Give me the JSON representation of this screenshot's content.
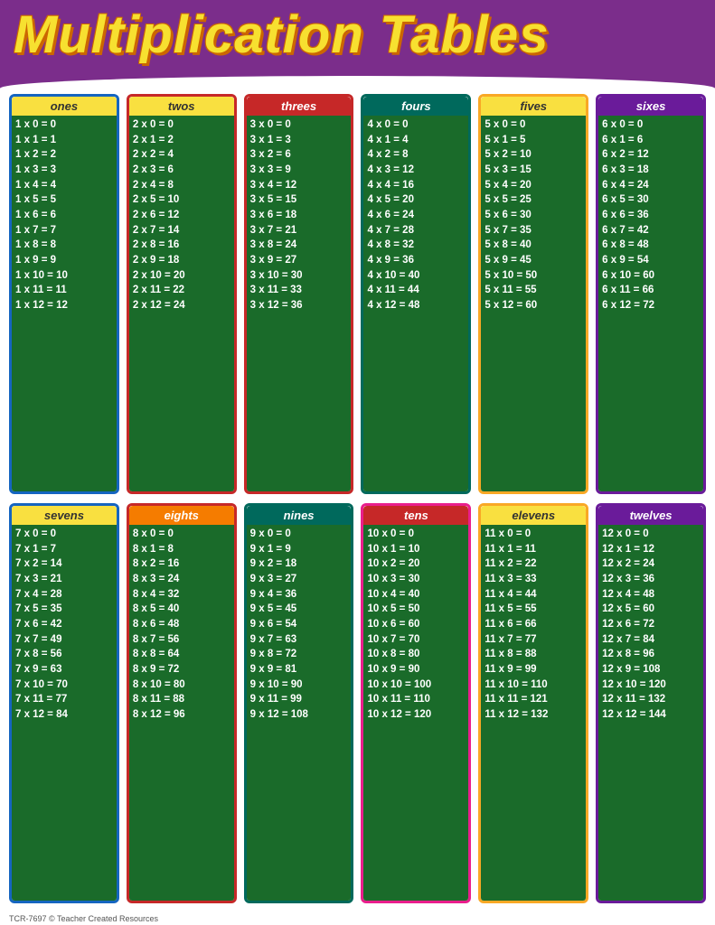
{
  "header": {
    "title": "Multiplication Tables"
  },
  "footer": "TCR-7697  © Teacher Created Resources",
  "tables": [
    {
      "name": "ones",
      "headerClass": "header-yellow",
      "borderClass": "border-blue",
      "rows": [
        "1x0=0",
        "1x1=1",
        "1x2=2",
        "1x3=3",
        "1x4=4",
        "1x5=5",
        "1x6=6",
        "1x7=7",
        "1x8=8",
        "1x9=9",
        "1x10=10",
        "1x11=11",
        "1x12=12"
      ]
    },
    {
      "name": "twos",
      "headerClass": "header-yellow",
      "borderClass": "border-red",
      "rows": [
        "2x0=0",
        "2x1=2",
        "2x2=4",
        "2x3=6",
        "2x4=8",
        "2x5=10",
        "2x6=12",
        "2x7=14",
        "2x8=16",
        "2x9=18",
        "2x10=20",
        "2x11=22",
        "2x12=24"
      ]
    },
    {
      "name": "threes",
      "headerClass": "header-red",
      "borderClass": "border-red",
      "rows": [
        "3x0=0",
        "3x1=3",
        "3x2=6",
        "3x3=9",
        "3x4=12",
        "3x5=15",
        "3x6=18",
        "3x7=21",
        "3x8=24",
        "3x9=27",
        "3x10=30",
        "3x11=33",
        "3x12=36"
      ]
    },
    {
      "name": "fours",
      "headerClass": "header-teal",
      "borderClass": "border-teal",
      "rows": [
        "4x0=0",
        "4x1=4",
        "4x2=8",
        "4x3=12",
        "4x4=16",
        "4x5=20",
        "4x6=24",
        "4x7=28",
        "4x8=32",
        "4x9=36",
        "4x10=40",
        "4x11=44",
        "4x12=48"
      ]
    },
    {
      "name": "fives",
      "headerClass": "header-yellow",
      "borderClass": "border-yellow",
      "rows": [
        "5x0=0",
        "5x1=5",
        "5x2=10",
        "5x3=15",
        "5x4=20",
        "5x5=25",
        "5x6=30",
        "5x7=35",
        "5x8=40",
        "5x9=45",
        "5x10=50",
        "5x11=55",
        "5x12=60"
      ]
    },
    {
      "name": "sixes",
      "headerClass": "header-purple",
      "borderClass": "border-purple",
      "rows": [
        "6x0=0",
        "6x1=6",
        "6x2=12",
        "6x3=18",
        "6x4=24",
        "6x5=30",
        "6x6=36",
        "6x7=42",
        "6x8=48",
        "6x9=54",
        "6x10=60",
        "6x11=66",
        "6x12=72"
      ]
    },
    {
      "name": "sevens",
      "headerClass": "header-yellow",
      "borderClass": "border-blue",
      "rows": [
        "7x0=0",
        "7x1=7",
        "7x2=14",
        "7x3=21",
        "7x4=28",
        "7x5=35",
        "7x6=42",
        "7x7=49",
        "7x8=56",
        "7x9=63",
        "7x10=70",
        "7x11=77",
        "7x12=84"
      ]
    },
    {
      "name": "eights",
      "headerClass": "header-orange",
      "borderClass": "border-red",
      "rows": [
        "8x0=0",
        "8x1=8",
        "8x2=16",
        "8x3=24",
        "8x4=32",
        "8x5=40",
        "8x6=48",
        "8x7=56",
        "8x8=64",
        "8x9=72",
        "8x10=80",
        "8x11=88",
        "8x12=96"
      ]
    },
    {
      "name": "nines",
      "headerClass": "header-teal",
      "borderClass": "border-teal",
      "rows": [
        "9x0=0",
        "9x1=9",
        "9x2=18",
        "9x3=27",
        "9x4=36",
        "9x5=45",
        "9x6=54",
        "9x7=63",
        "9x8=72",
        "9x9=81",
        "9x10=90",
        "9x11=99",
        "9x12=108"
      ]
    },
    {
      "name": "tens",
      "headerClass": "header-red",
      "borderClass": "border-pink",
      "rows": [
        "10x0=0",
        "10x1=10",
        "10x2=20",
        "10x3=30",
        "10x4=40",
        "10x5=50",
        "10x6=60",
        "10x7=70",
        "10x8=80",
        "10x9=90",
        "10x10=100",
        "10x11=110",
        "10x12=120"
      ]
    },
    {
      "name": "elevens",
      "headerClass": "header-yellow",
      "borderClass": "border-yellow",
      "rows": [
        "11x0=0",
        "11x1=11",
        "11x2=22",
        "11x3=33",
        "11x4=44",
        "11x5=55",
        "11x6=66",
        "11x7=77",
        "11x8=88",
        "11x9=99",
        "11x10=110",
        "11x11=121",
        "11x12=132"
      ]
    },
    {
      "name": "twelves",
      "headerClass": "header-purple",
      "borderClass": "border-purple",
      "rows": [
        "12x0=0",
        "12x1=12",
        "12x2=24",
        "12x3=36",
        "12x4=48",
        "12x5=60",
        "12x6=72",
        "12x7=84",
        "12x8=96",
        "12x9=108",
        "12x10=120",
        "12x11=132",
        "12x12=144"
      ]
    }
  ]
}
